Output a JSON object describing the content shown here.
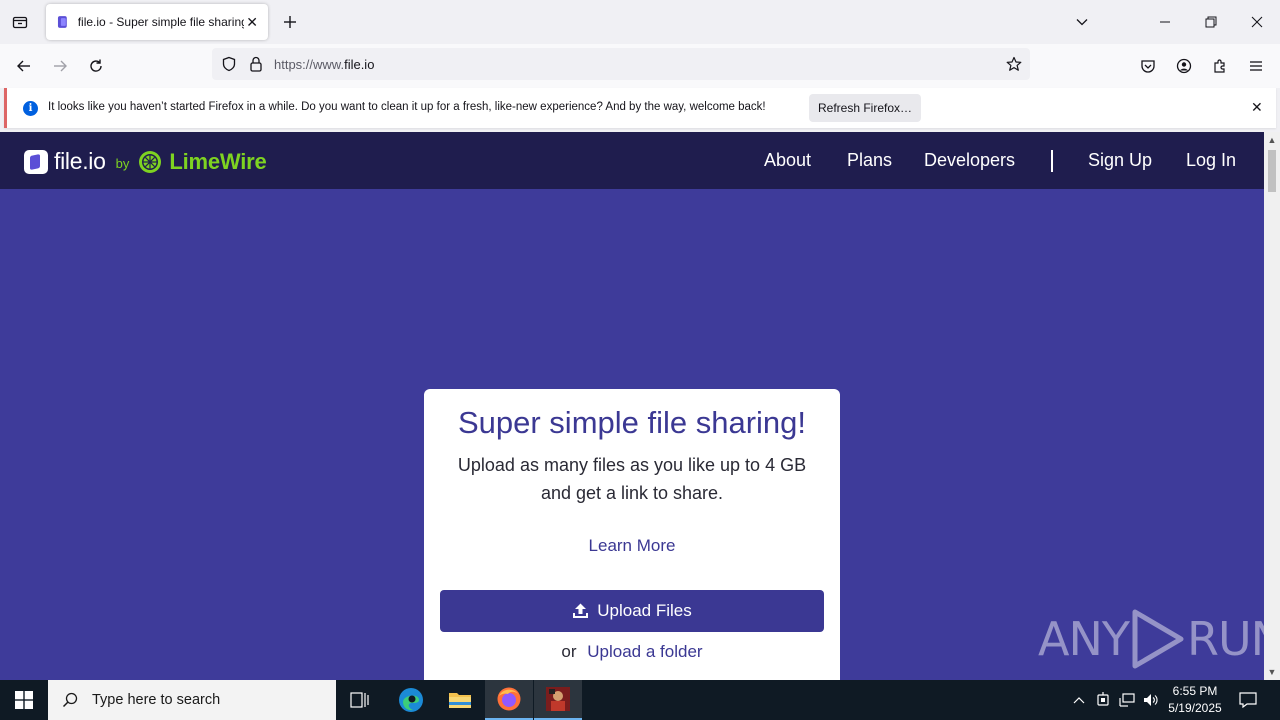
{
  "browser": {
    "tab": {
      "title": "file.io - Super simple file sharing"
    },
    "url": {
      "prefix": "https://www.",
      "host": "file.io"
    },
    "notification": {
      "text": "It looks like you haven’t started Firefox in a while. Do you want to clean it up for a fresh, like-new experience? And by the way, welcome back!",
      "button": "Refresh Firefox…"
    }
  },
  "site": {
    "logo": {
      "name": "file.io",
      "by": "by",
      "partner": "LimeWire"
    },
    "nav": {
      "about": "About",
      "plans": "Plans",
      "developers": "Developers",
      "sign_up": "Sign Up",
      "log_in": "Log In"
    },
    "card": {
      "title": "Super simple file sharing!",
      "subtitle_line1": "Upload as many files as you like up to 4 GB",
      "subtitle_line2": "and get a link to share.",
      "learn_more": "Learn More",
      "upload_button": "Upload Files",
      "or": "or",
      "upload_folder": "Upload a folder"
    },
    "watermark": {
      "left": "ANY",
      "right": "RUN"
    }
  },
  "taskbar": {
    "search_placeholder": "Type here to search",
    "time": "6:55 PM",
    "date": "5/19/2025",
    "icons": [
      "windows-start-icon",
      "task-view-icon",
      "edge-icon",
      "file-explorer-icon",
      "firefox-icon",
      "app-icon"
    ]
  },
  "colors": {
    "page_background": "#3e3b9a",
    "header_background": "#1f1d4e",
    "brand_purple": "#3b3893",
    "limewire_green": "#7ed321"
  }
}
